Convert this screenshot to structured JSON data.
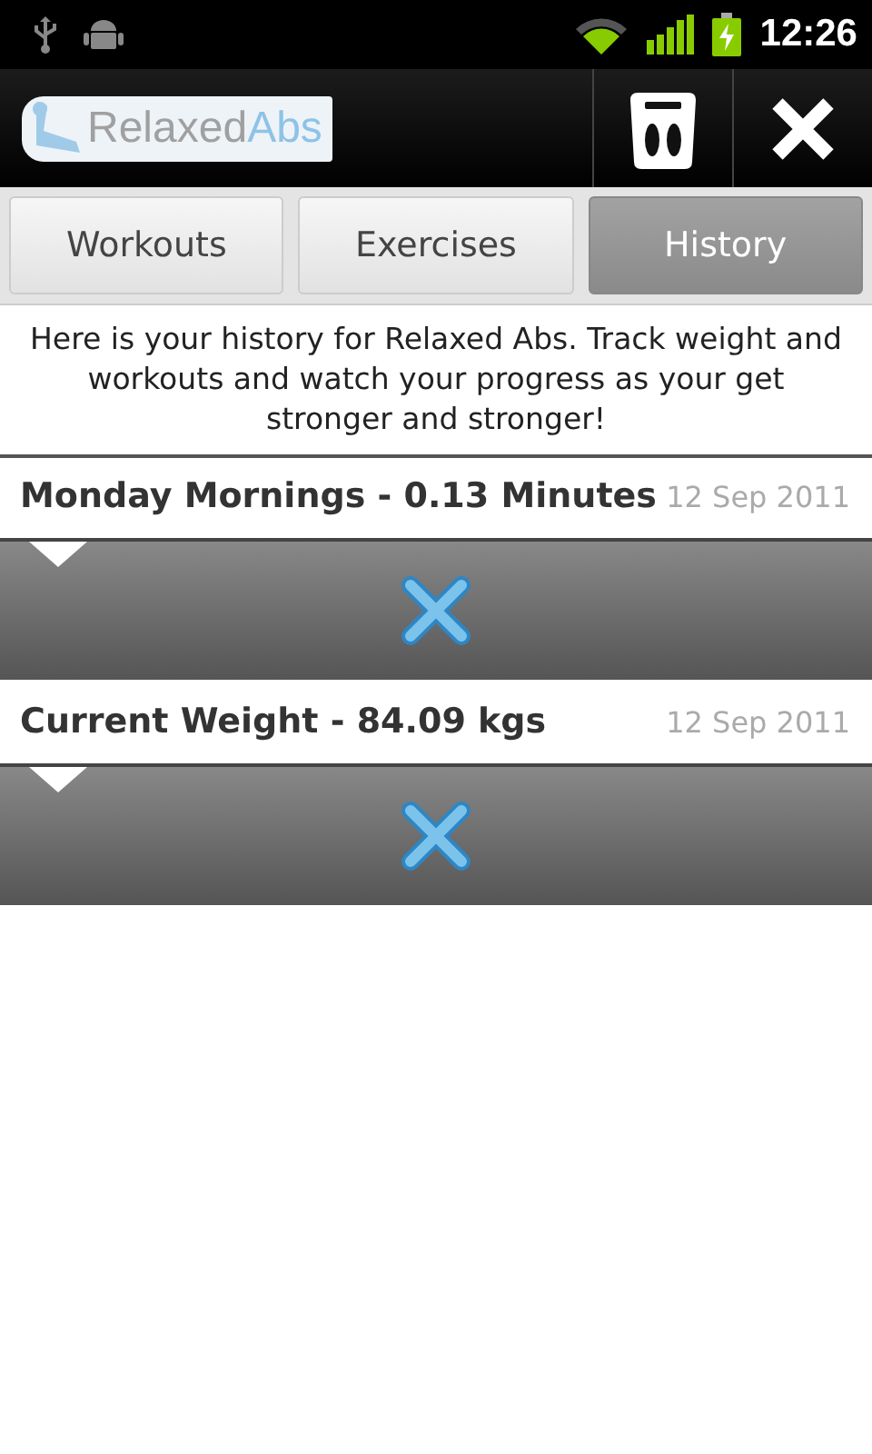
{
  "status_bar": {
    "time": "12:26"
  },
  "app_bar": {
    "logo": {
      "first": "Relaxed",
      "second": "Abs"
    }
  },
  "tabs": [
    {
      "label": "Workouts",
      "selected": false
    },
    {
      "label": "Exercises",
      "selected": false
    },
    {
      "label": "History",
      "selected": true
    }
  ],
  "intro": "Here is your history for Relaxed Abs. Track weight and workouts and watch your progress as your get stronger and stronger!",
  "entries": [
    {
      "title": "Monday Mornings - 0.13 Minutes",
      "date": "12 Sep 2011"
    },
    {
      "title": "Current Weight - 84.09 kgs",
      "date": "12 Sep 2011"
    }
  ]
}
